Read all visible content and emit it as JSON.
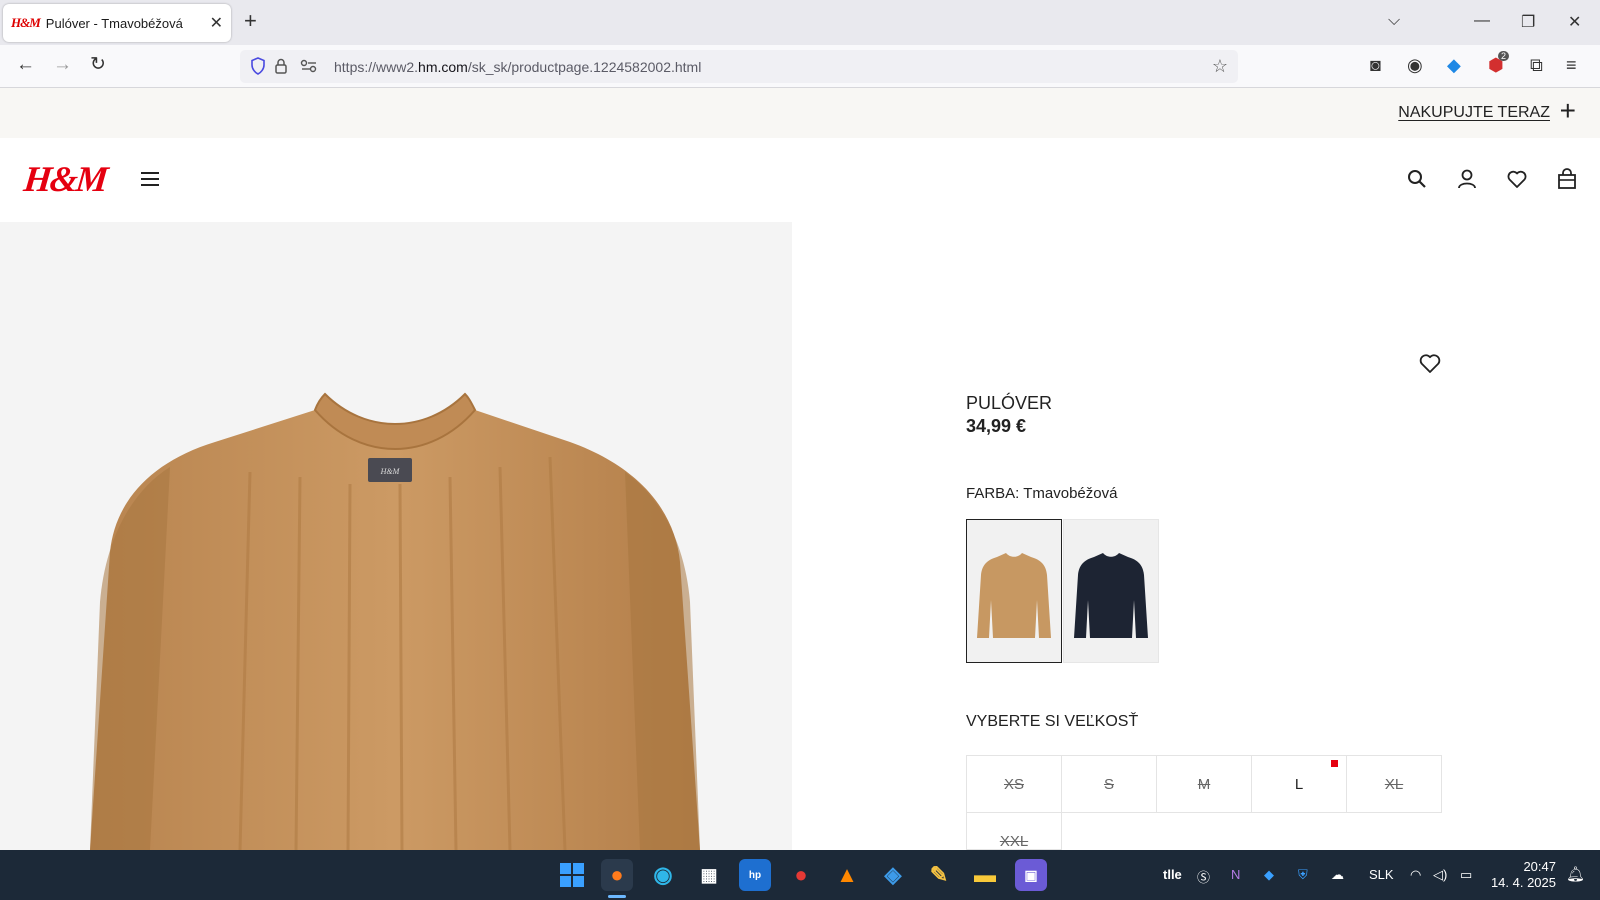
{
  "browser": {
    "tab_title": "Pulóver - Tmavobéžová",
    "tab_favicon": "H&M",
    "url_prefix": "https://www2.",
    "url_domain": "hm.com",
    "url_path": "/sk_sk/productpage.1224582002.html",
    "extension_badge": "2"
  },
  "promo": {
    "cta_label": "NAKUPUJTE TERAZ"
  },
  "header": {
    "logo": "H&M"
  },
  "product": {
    "name": "PULÓVER",
    "price": "34,99 €",
    "color_label": "FARBA: Tmavobéžová",
    "swatch_colors": [
      "#c79862",
      "#1d2433"
    ],
    "size_title": "VYBERTE SI VEĽKOSŤ",
    "sizes": [
      {
        "label": "XS",
        "available": false
      },
      {
        "label": "S",
        "available": false
      },
      {
        "label": "M",
        "available": false
      },
      {
        "label": "L",
        "available": true,
        "low_stock": true
      },
      {
        "label": "XL",
        "available": false
      },
      {
        "label": "XXL",
        "available": false
      }
    ],
    "accent_color": "#e50010"
  },
  "taskbar": {
    "tray_text": "tlle",
    "language": "SLK",
    "time": "20:47",
    "date": "14. 4. 2025"
  }
}
